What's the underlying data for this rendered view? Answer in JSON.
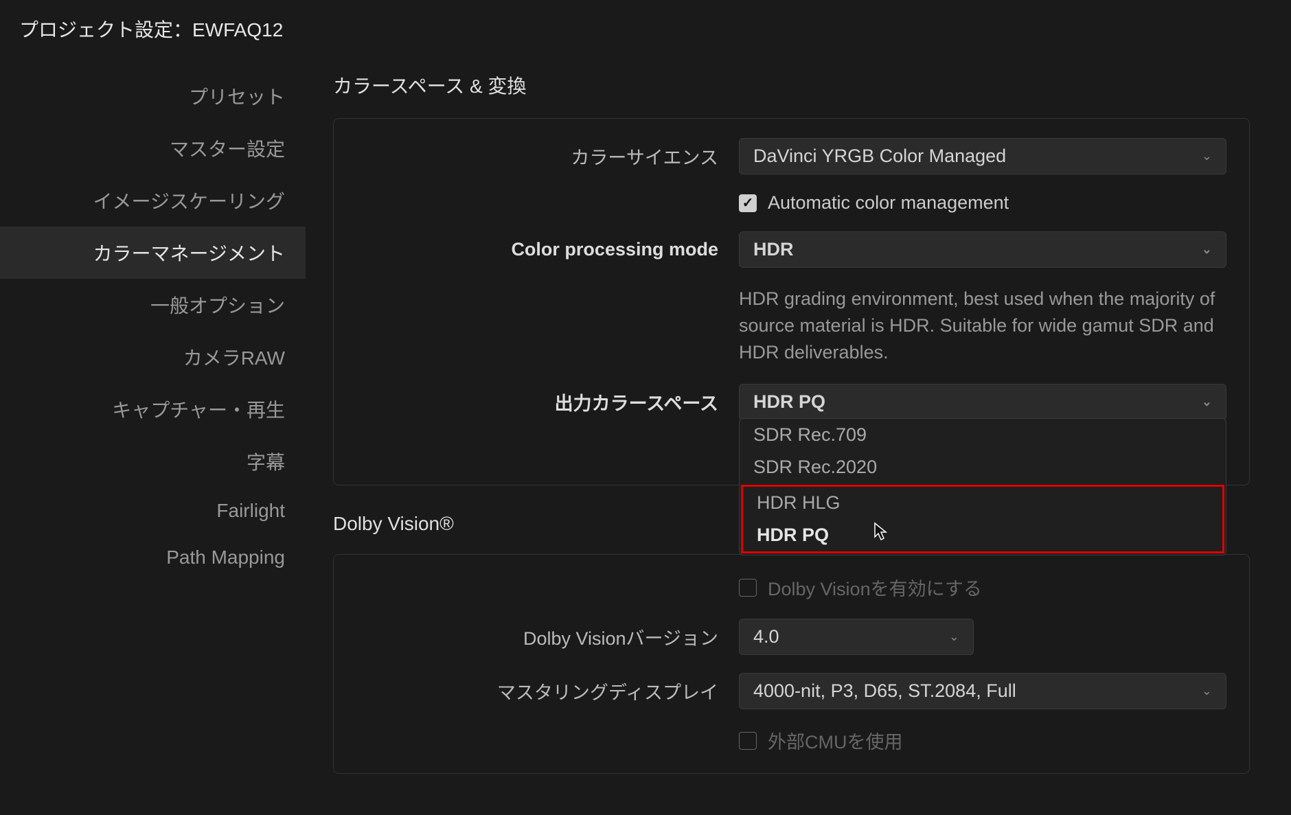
{
  "title": "プロジェクト設定：EWFAQ12",
  "sidebar": [
    "プリセット",
    "マスター設定",
    "イメージスケーリング",
    "カラーマネージメント",
    "一般オプション",
    "カメラRAW",
    "キャプチャー・再生",
    "字幕",
    "Fairlight",
    "Path Mapping"
  ],
  "sidebar_active_index": 3,
  "section1": {
    "title": "カラースペース & 変換",
    "labels": {
      "color_science": "カラーサイエンス",
      "color_processing_mode": "Color processing mode",
      "output_colorspace": "出力カラースペース"
    },
    "color_science_value": "DaVinci YRGB Color Managed",
    "auto_cm_label": "Automatic color management",
    "auto_cm_checked": true,
    "processing_mode_value": "HDR",
    "processing_desc": "HDR grading environment, best used when the majority of source material is HDR. Suitable for wide gamut SDR and HDR deliverables.",
    "output_value": "HDR PQ",
    "output_options": [
      "SDR Rec.709",
      "SDR Rec.2020",
      "HDR HLG",
      "HDR PQ"
    ],
    "output_selected_index": 3
  },
  "section2": {
    "title": "Dolby Vision®",
    "labels": {
      "dv_version": "Dolby Visionバージョン",
      "mastering_display": "マスタリングディスプレイ"
    },
    "enable_dv_label": "Dolby Visionを有効にする",
    "enable_dv_checked": false,
    "version_value": "4.0",
    "mastering_value": "4000-nit, P3, D65, ST.2084, Full",
    "external_cmu_label": "外部CMUを使用",
    "external_cmu_checked": false
  }
}
